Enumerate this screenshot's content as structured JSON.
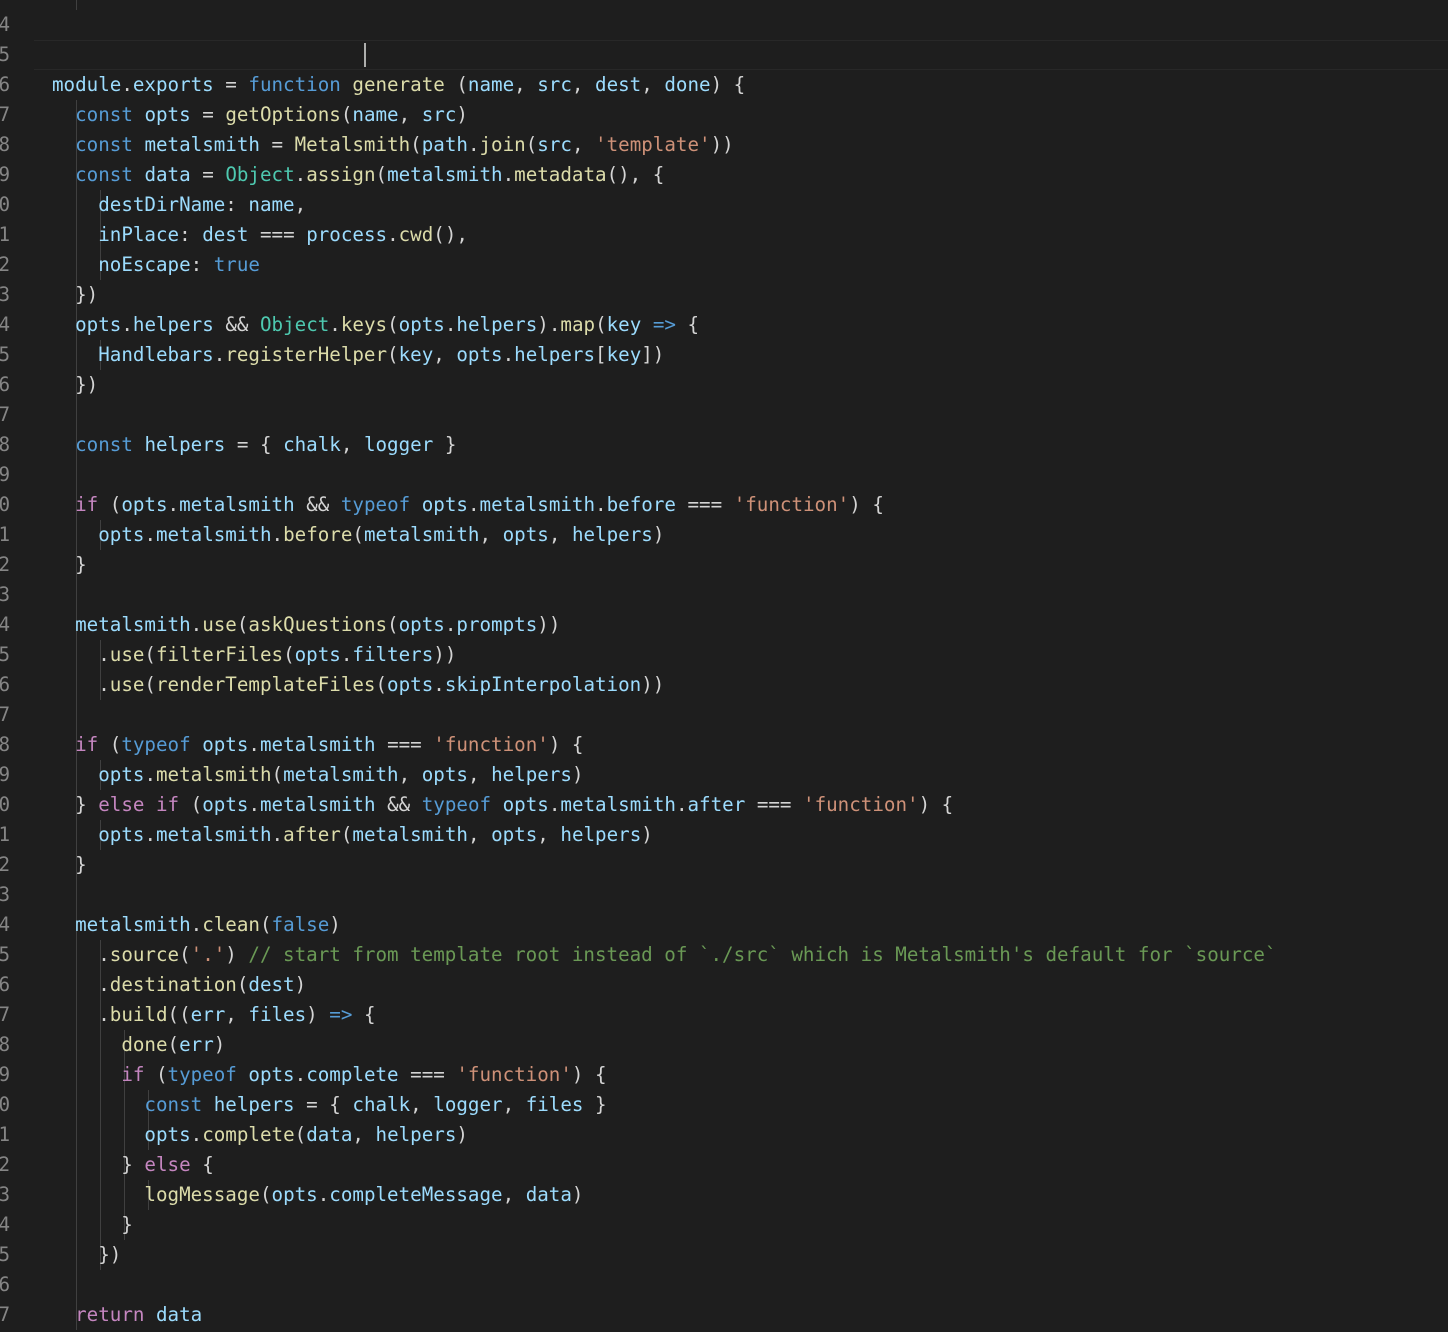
{
  "editor": {
    "language": "javascript",
    "theme_colors": {
      "background": "#1e1e1e",
      "keyword": "#569cd6",
      "control": "#c586c0",
      "function": "#dcdcaa",
      "variable": "#9cdcfe",
      "string": "#ce9178",
      "type": "#4ec9b0",
      "comment": "#6a9955",
      "punctuation": "#d4d4d4",
      "line_number": "#858585"
    },
    "gutter_digits": [
      "4",
      "5",
      "6",
      "7",
      "8",
      "9",
      "0",
      "1",
      "2",
      "3",
      "4",
      "5",
      "6",
      "7",
      "8",
      "9",
      "0",
      "1",
      "2",
      "3",
      "4",
      "5",
      "6",
      "7",
      "8",
      "9",
      "0",
      "1",
      "2",
      "3",
      "4",
      "5",
      "6",
      "7",
      "8",
      "9",
      "0",
      "1",
      "2",
      "3",
      "4",
      "5",
      "6",
      "7"
    ],
    "lines": [
      [],
      [
        [
          "v",
          "module"
        ],
        [
          "p",
          "."
        ],
        [
          "v",
          "exports"
        ],
        [
          "p",
          " = "
        ],
        [
          "k",
          "function"
        ],
        [
          "p",
          " "
        ],
        [
          "f",
          "generate"
        ],
        [
          "p",
          " ("
        ],
        [
          "v",
          "name"
        ],
        [
          "p",
          ", "
        ],
        [
          "v",
          "src"
        ],
        [
          "p",
          ", "
        ],
        [
          "v",
          "dest"
        ],
        [
          "p",
          ", "
        ],
        [
          "v",
          "done"
        ],
        [
          "p",
          ") {"
        ]
      ],
      [
        [
          "p",
          "  "
        ],
        [
          "k",
          "const"
        ],
        [
          "p",
          " "
        ],
        [
          "v",
          "opts"
        ],
        [
          "p",
          " = "
        ],
        [
          "f",
          "getOptions"
        ],
        [
          "p",
          "("
        ],
        [
          "v",
          "name"
        ],
        [
          "p",
          ", "
        ],
        [
          "v",
          "src"
        ],
        [
          "p",
          ")"
        ]
      ],
      [
        [
          "p",
          "  "
        ],
        [
          "k",
          "const"
        ],
        [
          "p",
          " "
        ],
        [
          "v",
          "metalsmith"
        ],
        [
          "p",
          " = "
        ],
        [
          "f",
          "Metalsmith"
        ],
        [
          "p",
          "("
        ],
        [
          "v",
          "path"
        ],
        [
          "p",
          "."
        ],
        [
          "f",
          "join"
        ],
        [
          "p",
          "("
        ],
        [
          "v",
          "src"
        ],
        [
          "p",
          ", "
        ],
        [
          "s",
          "'template'"
        ],
        [
          "p",
          "))"
        ]
      ],
      [
        [
          "p",
          "  "
        ],
        [
          "k",
          "const"
        ],
        [
          "p",
          " "
        ],
        [
          "v",
          "data"
        ],
        [
          "p",
          " = "
        ],
        [
          "t",
          "Object"
        ],
        [
          "p",
          "."
        ],
        [
          "f",
          "assign"
        ],
        [
          "p",
          "("
        ],
        [
          "v",
          "metalsmith"
        ],
        [
          "p",
          "."
        ],
        [
          "f",
          "metadata"
        ],
        [
          "p",
          "(), {"
        ]
      ],
      [
        [
          "p",
          "    "
        ],
        [
          "v",
          "destDirName"
        ],
        [
          "p",
          ": "
        ],
        [
          "v",
          "name"
        ],
        [
          "p",
          ","
        ]
      ],
      [
        [
          "p",
          "    "
        ],
        [
          "v",
          "inPlace"
        ],
        [
          "p",
          ": "
        ],
        [
          "v",
          "dest"
        ],
        [
          "p",
          " === "
        ],
        [
          "v",
          "process"
        ],
        [
          "p",
          "."
        ],
        [
          "f",
          "cwd"
        ],
        [
          "p",
          "(),"
        ]
      ],
      [
        [
          "p",
          "    "
        ],
        [
          "v",
          "noEscape"
        ],
        [
          "p",
          ": "
        ],
        [
          "k",
          "true"
        ]
      ],
      [
        [
          "p",
          "  })"
        ]
      ],
      [
        [
          "p",
          "  "
        ],
        [
          "v",
          "opts"
        ],
        [
          "p",
          "."
        ],
        [
          "v",
          "helpers"
        ],
        [
          "p",
          " && "
        ],
        [
          "t",
          "Object"
        ],
        [
          "p",
          "."
        ],
        [
          "f",
          "keys"
        ],
        [
          "p",
          "("
        ],
        [
          "v",
          "opts"
        ],
        [
          "p",
          "."
        ],
        [
          "v",
          "helpers"
        ],
        [
          "p",
          ")."
        ],
        [
          "f",
          "map"
        ],
        [
          "p",
          "("
        ],
        [
          "v",
          "key"
        ],
        [
          "p",
          " "
        ],
        [
          "k",
          "=>"
        ],
        [
          "p",
          " {"
        ]
      ],
      [
        [
          "p",
          "    "
        ],
        [
          "v",
          "Handlebars"
        ],
        [
          "p",
          "."
        ],
        [
          "f",
          "registerHelper"
        ],
        [
          "p",
          "("
        ],
        [
          "v",
          "key"
        ],
        [
          "p",
          ", "
        ],
        [
          "v",
          "opts"
        ],
        [
          "p",
          "."
        ],
        [
          "v",
          "helpers"
        ],
        [
          "p",
          "["
        ],
        [
          "v",
          "key"
        ],
        [
          "p",
          "])"
        ]
      ],
      [
        [
          "p",
          "  })"
        ]
      ],
      [],
      [
        [
          "p",
          "  "
        ],
        [
          "k",
          "const"
        ],
        [
          "p",
          " "
        ],
        [
          "v",
          "helpers"
        ],
        [
          "p",
          " = { "
        ],
        [
          "v",
          "chalk"
        ],
        [
          "p",
          ", "
        ],
        [
          "v",
          "logger"
        ],
        [
          "p",
          " }"
        ]
      ],
      [],
      [
        [
          "p",
          "  "
        ],
        [
          "c",
          "if"
        ],
        [
          "p",
          " ("
        ],
        [
          "v",
          "opts"
        ],
        [
          "p",
          "."
        ],
        [
          "v",
          "metalsmith"
        ],
        [
          "p",
          " && "
        ],
        [
          "k",
          "typeof"
        ],
        [
          "p",
          " "
        ],
        [
          "v",
          "opts"
        ],
        [
          "p",
          "."
        ],
        [
          "v",
          "metalsmith"
        ],
        [
          "p",
          "."
        ],
        [
          "v",
          "before"
        ],
        [
          "p",
          " === "
        ],
        [
          "s",
          "'function'"
        ],
        [
          "p",
          ") {"
        ]
      ],
      [
        [
          "p",
          "    "
        ],
        [
          "v",
          "opts"
        ],
        [
          "p",
          "."
        ],
        [
          "v",
          "metalsmith"
        ],
        [
          "p",
          "."
        ],
        [
          "f",
          "before"
        ],
        [
          "p",
          "("
        ],
        [
          "v",
          "metalsmith"
        ],
        [
          "p",
          ", "
        ],
        [
          "v",
          "opts"
        ],
        [
          "p",
          ", "
        ],
        [
          "v",
          "helpers"
        ],
        [
          "p",
          ")"
        ]
      ],
      [
        [
          "p",
          "  }"
        ]
      ],
      [],
      [
        [
          "p",
          "  "
        ],
        [
          "v",
          "metalsmith"
        ],
        [
          "p",
          "."
        ],
        [
          "f",
          "use"
        ],
        [
          "p",
          "("
        ],
        [
          "f",
          "askQuestions"
        ],
        [
          "p",
          "("
        ],
        [
          "v",
          "opts"
        ],
        [
          "p",
          "."
        ],
        [
          "v",
          "prompts"
        ],
        [
          "p",
          "))"
        ]
      ],
      [
        [
          "p",
          "    ."
        ],
        [
          "f",
          "use"
        ],
        [
          "p",
          "("
        ],
        [
          "f",
          "filterFiles"
        ],
        [
          "p",
          "("
        ],
        [
          "v",
          "opts"
        ],
        [
          "p",
          "."
        ],
        [
          "v",
          "filters"
        ],
        [
          "p",
          "))"
        ]
      ],
      [
        [
          "p",
          "    ."
        ],
        [
          "f",
          "use"
        ],
        [
          "p",
          "("
        ],
        [
          "f",
          "renderTemplateFiles"
        ],
        [
          "p",
          "("
        ],
        [
          "v",
          "opts"
        ],
        [
          "p",
          "."
        ],
        [
          "v",
          "skipInterpolation"
        ],
        [
          "p",
          "))"
        ]
      ],
      [],
      [
        [
          "p",
          "  "
        ],
        [
          "c",
          "if"
        ],
        [
          "p",
          " ("
        ],
        [
          "k",
          "typeof"
        ],
        [
          "p",
          " "
        ],
        [
          "v",
          "opts"
        ],
        [
          "p",
          "."
        ],
        [
          "v",
          "metalsmith"
        ],
        [
          "p",
          " === "
        ],
        [
          "s",
          "'function'"
        ],
        [
          "p",
          ") {"
        ]
      ],
      [
        [
          "p",
          "    "
        ],
        [
          "v",
          "opts"
        ],
        [
          "p",
          "."
        ],
        [
          "f",
          "metalsmith"
        ],
        [
          "p",
          "("
        ],
        [
          "v",
          "metalsmith"
        ],
        [
          "p",
          ", "
        ],
        [
          "v",
          "opts"
        ],
        [
          "p",
          ", "
        ],
        [
          "v",
          "helpers"
        ],
        [
          "p",
          ")"
        ]
      ],
      [
        [
          "p",
          "  } "
        ],
        [
          "c",
          "else"
        ],
        [
          "p",
          " "
        ],
        [
          "c",
          "if"
        ],
        [
          "p",
          " ("
        ],
        [
          "v",
          "opts"
        ],
        [
          "p",
          "."
        ],
        [
          "v",
          "metalsmith"
        ],
        [
          "p",
          " && "
        ],
        [
          "k",
          "typeof"
        ],
        [
          "p",
          " "
        ],
        [
          "v",
          "opts"
        ],
        [
          "p",
          "."
        ],
        [
          "v",
          "metalsmith"
        ],
        [
          "p",
          "."
        ],
        [
          "v",
          "after"
        ],
        [
          "p",
          " === "
        ],
        [
          "s",
          "'function'"
        ],
        [
          "p",
          ") {"
        ]
      ],
      [
        [
          "p",
          "    "
        ],
        [
          "v",
          "opts"
        ],
        [
          "p",
          "."
        ],
        [
          "v",
          "metalsmith"
        ],
        [
          "p",
          "."
        ],
        [
          "f",
          "after"
        ],
        [
          "p",
          "("
        ],
        [
          "v",
          "metalsmith"
        ],
        [
          "p",
          ", "
        ],
        [
          "v",
          "opts"
        ],
        [
          "p",
          ", "
        ],
        [
          "v",
          "helpers"
        ],
        [
          "p",
          ")"
        ]
      ],
      [
        [
          "p",
          "  }"
        ]
      ],
      [],
      [
        [
          "p",
          "  "
        ],
        [
          "v",
          "metalsmith"
        ],
        [
          "p",
          "."
        ],
        [
          "f",
          "clean"
        ],
        [
          "p",
          "("
        ],
        [
          "k",
          "false"
        ],
        [
          "p",
          ")"
        ]
      ],
      [
        [
          "p",
          "    ."
        ],
        [
          "f",
          "source"
        ],
        [
          "p",
          "("
        ],
        [
          "s",
          "'.'"
        ],
        [
          "p",
          ") "
        ],
        [
          "m",
          "// start from template root instead of `./src` which is Metalsmith's default for `source`"
        ]
      ],
      [
        [
          "p",
          "    ."
        ],
        [
          "f",
          "destination"
        ],
        [
          "p",
          "("
        ],
        [
          "v",
          "dest"
        ],
        [
          "p",
          ")"
        ]
      ],
      [
        [
          "p",
          "    ."
        ],
        [
          "f",
          "build"
        ],
        [
          "p",
          "(("
        ],
        [
          "v",
          "err"
        ],
        [
          "p",
          ", "
        ],
        [
          "v",
          "files"
        ],
        [
          "p",
          ") "
        ],
        [
          "k",
          "=>"
        ],
        [
          "p",
          " {"
        ]
      ],
      [
        [
          "p",
          "      "
        ],
        [
          "f",
          "done"
        ],
        [
          "p",
          "("
        ],
        [
          "v",
          "err"
        ],
        [
          "p",
          ")"
        ]
      ],
      [
        [
          "p",
          "      "
        ],
        [
          "c",
          "if"
        ],
        [
          "p",
          " ("
        ],
        [
          "k",
          "typeof"
        ],
        [
          "p",
          " "
        ],
        [
          "v",
          "opts"
        ],
        [
          "p",
          "."
        ],
        [
          "v",
          "complete"
        ],
        [
          "p",
          " === "
        ],
        [
          "s",
          "'function'"
        ],
        [
          "p",
          ") {"
        ]
      ],
      [
        [
          "p",
          "        "
        ],
        [
          "k",
          "const"
        ],
        [
          "p",
          " "
        ],
        [
          "v",
          "helpers"
        ],
        [
          "p",
          " = { "
        ],
        [
          "v",
          "chalk"
        ],
        [
          "p",
          ", "
        ],
        [
          "v",
          "logger"
        ],
        [
          "p",
          ", "
        ],
        [
          "v",
          "files"
        ],
        [
          "p",
          " }"
        ]
      ],
      [
        [
          "p",
          "        "
        ],
        [
          "v",
          "opts"
        ],
        [
          "p",
          "."
        ],
        [
          "f",
          "complete"
        ],
        [
          "p",
          "("
        ],
        [
          "v",
          "data"
        ],
        [
          "p",
          ", "
        ],
        [
          "v",
          "helpers"
        ],
        [
          "p",
          ")"
        ]
      ],
      [
        [
          "p",
          "      } "
        ],
        [
          "c",
          "else"
        ],
        [
          "p",
          " {"
        ]
      ],
      [
        [
          "p",
          "        "
        ],
        [
          "f",
          "logMessage"
        ],
        [
          "p",
          "("
        ],
        [
          "v",
          "opts"
        ],
        [
          "p",
          "."
        ],
        [
          "v",
          "completeMessage"
        ],
        [
          "p",
          ", "
        ],
        [
          "v",
          "data"
        ],
        [
          "p",
          ")"
        ]
      ],
      [
        [
          "p",
          "      }"
        ]
      ],
      [
        [
          "p",
          "    })"
        ]
      ],
      [],
      [
        [
          "p",
          "  "
        ],
        [
          "c",
          "return"
        ],
        [
          "p",
          " "
        ],
        [
          "v",
          "data"
        ]
      ],
      [
        [
          "p",
          "}"
        ]
      ]
    ]
  }
}
